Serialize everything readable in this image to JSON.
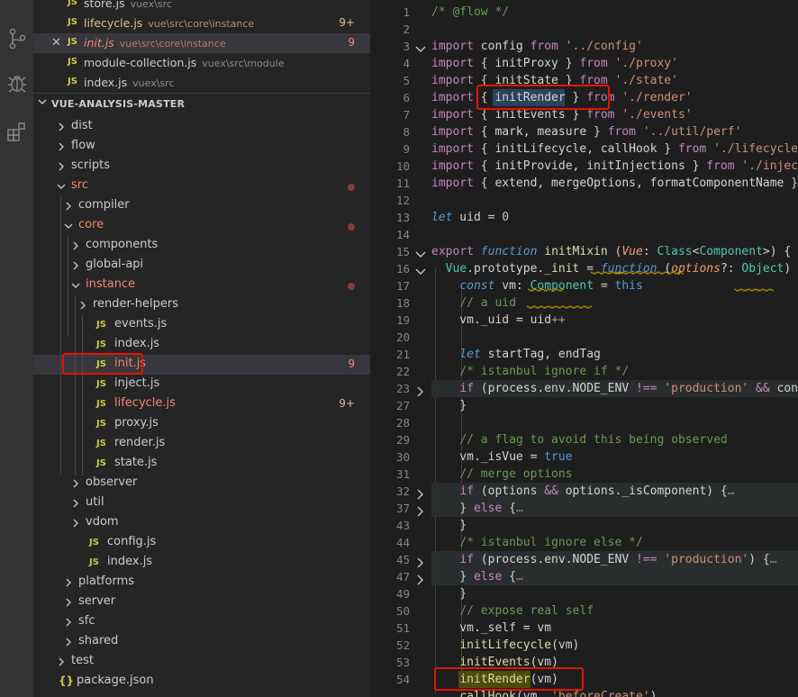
{
  "activity": [
    {
      "name": "source-control-icon"
    },
    {
      "name": "debug-icon"
    },
    {
      "name": "extensions-icon"
    }
  ],
  "open_editors": [
    {
      "name": "store.js",
      "path": "vuex\\src",
      "status": "normal",
      "badge": ""
    },
    {
      "name": "lifecycle.js",
      "path": "vue\\src\\core\\instance",
      "status": "modified",
      "badge": "9+"
    },
    {
      "name": "init.js",
      "path": "vue\\src\\core\\instance",
      "status": "error",
      "badge": "9"
    },
    {
      "name": "module-collection.js",
      "path": "vuex\\src\\module",
      "status": "normal",
      "badge": ""
    },
    {
      "name": "index.js",
      "path": "vuex\\src",
      "status": "normal",
      "badge": ""
    }
  ],
  "explorer": {
    "section_title": "VUE-ANALYSIS-MASTER",
    "tree": [
      {
        "label": "dist",
        "kind": "folder",
        "depth": 0,
        "expanded": false
      },
      {
        "label": "flow",
        "kind": "folder",
        "depth": 0,
        "expanded": false
      },
      {
        "label": "scripts",
        "kind": "folder",
        "depth": 0,
        "expanded": false
      },
      {
        "label": "src",
        "kind": "folder",
        "depth": 0,
        "expanded": true,
        "status": "err-dot"
      },
      {
        "label": "compiler",
        "kind": "folder",
        "depth": 1,
        "expanded": false
      },
      {
        "label": "core",
        "kind": "folder",
        "depth": 1,
        "expanded": true,
        "status": "err-dot"
      },
      {
        "label": "components",
        "kind": "folder",
        "depth": 2,
        "expanded": false
      },
      {
        "label": "global-api",
        "kind": "folder",
        "depth": 2,
        "expanded": false
      },
      {
        "label": "instance",
        "kind": "folder",
        "depth": 2,
        "expanded": true,
        "status": "err-dot"
      },
      {
        "label": "render-helpers",
        "kind": "folder",
        "depth": 3,
        "expanded": false
      },
      {
        "label": "events.js",
        "kind": "js",
        "depth": 3
      },
      {
        "label": "index.js",
        "kind": "js",
        "depth": 3
      },
      {
        "label": "init.js",
        "kind": "js",
        "depth": 3,
        "status": "err",
        "badge": "9",
        "selected": true
      },
      {
        "label": "inject.js",
        "kind": "js",
        "depth": 3
      },
      {
        "label": "lifecycle.js",
        "kind": "js",
        "depth": 3,
        "status": "mod",
        "badge": "9+"
      },
      {
        "label": "proxy.js",
        "kind": "js",
        "depth": 3
      },
      {
        "label": "render.js",
        "kind": "js",
        "depth": 3
      },
      {
        "label": "state.js",
        "kind": "js",
        "depth": 3
      },
      {
        "label": "observer",
        "kind": "folder",
        "depth": 2,
        "expanded": false
      },
      {
        "label": "util",
        "kind": "folder",
        "depth": 2,
        "expanded": false
      },
      {
        "label": "vdom",
        "kind": "folder",
        "depth": 2,
        "expanded": false
      },
      {
        "label": "config.js",
        "kind": "js",
        "depth": 2
      },
      {
        "label": "index.js",
        "kind": "js",
        "depth": 2
      },
      {
        "label": "platforms",
        "kind": "folder",
        "depth": 1,
        "expanded": false
      },
      {
        "label": "server",
        "kind": "folder",
        "depth": 1,
        "expanded": false
      },
      {
        "label": "sfc",
        "kind": "folder",
        "depth": 1,
        "expanded": false
      },
      {
        "label": "shared",
        "kind": "folder",
        "depth": 1,
        "expanded": false
      },
      {
        "label": "test",
        "kind": "folder",
        "depth": 0,
        "expanded": false
      },
      {
        "label": "package.json",
        "kind": "json",
        "depth": 0
      }
    ]
  },
  "editor": {
    "lines": [
      {
        "n": "1",
        "fold": "",
        "bg": false,
        "t": [
          [
            "/* @flow */",
            "cm"
          ]
        ]
      },
      {
        "n": "2",
        "fold": "",
        "bg": false,
        "t": []
      },
      {
        "n": "3",
        "fold": "open",
        "bg": false,
        "t": [
          [
            "import",
            "kw"
          ],
          [
            " config ",
            ""
          ],
          [
            "from",
            "kw"
          ],
          [
            " ",
            ""
          ],
          [
            "'../config'",
            "st"
          ]
        ]
      },
      {
        "n": "4",
        "fold": "",
        "bg": false,
        "t": [
          [
            "import",
            "kw"
          ],
          [
            " { initProxy } ",
            ""
          ],
          [
            "from",
            "kw"
          ],
          [
            " ",
            ""
          ],
          [
            "'./proxy'",
            "st"
          ]
        ]
      },
      {
        "n": "5",
        "fold": "",
        "bg": false,
        "t": [
          [
            "import",
            "kw"
          ],
          [
            " { initState } ",
            ""
          ],
          [
            "from",
            "kw"
          ],
          [
            " ",
            ""
          ],
          [
            "'./state'",
            "st"
          ]
        ]
      },
      {
        "n": "6",
        "fold": "",
        "bg": false,
        "t": [
          [
            "import",
            "kw"
          ],
          [
            " { initRender } ",
            ""
          ],
          [
            "from",
            "kw"
          ],
          [
            " ",
            ""
          ],
          [
            "'./render'",
            "st"
          ]
        ]
      },
      {
        "n": "7",
        "fold": "",
        "bg": false,
        "t": [
          [
            "import",
            "kw"
          ],
          [
            " { initEvents } ",
            ""
          ],
          [
            "from",
            "kw"
          ],
          [
            " ",
            ""
          ],
          [
            "'./events'",
            "st"
          ]
        ]
      },
      {
        "n": "8",
        "fold": "",
        "bg": false,
        "t": [
          [
            "import",
            "kw"
          ],
          [
            " { mark, measure } ",
            ""
          ],
          [
            "from",
            "kw"
          ],
          [
            " ",
            ""
          ],
          [
            "'../util/perf'",
            "st"
          ]
        ]
      },
      {
        "n": "9",
        "fold": "",
        "bg": false,
        "t": [
          [
            "import",
            "kw"
          ],
          [
            " { initLifecycle, callHook } ",
            ""
          ],
          [
            "from",
            "kw"
          ],
          [
            " ",
            ""
          ],
          [
            "'./lifecycle'",
            "st"
          ]
        ]
      },
      {
        "n": "10",
        "fold": "",
        "bg": false,
        "t": [
          [
            "import",
            "kw"
          ],
          [
            " { initProvide, initInjections } ",
            ""
          ],
          [
            "from",
            "kw"
          ],
          [
            " ",
            ""
          ],
          [
            "'./inject",
            "st"
          ]
        ]
      },
      {
        "n": "11",
        "fold": "",
        "bg": false,
        "t": [
          [
            "import",
            "kw"
          ],
          [
            " { extend, mergeOptions, formatComponentName }",
            ""
          ]
        ]
      },
      {
        "n": "12",
        "fold": "",
        "bg": false,
        "t": []
      },
      {
        "n": "13",
        "fold": "",
        "bg": false,
        "t": [
          [
            "let",
            "sk"
          ],
          [
            " uid = ",
            ""
          ],
          [
            "0",
            "nm"
          ]
        ]
      },
      {
        "n": "14",
        "fold": "",
        "bg": false,
        "t": []
      },
      {
        "n": "15",
        "fold": "open",
        "bg": false,
        "t": [
          [
            "export",
            "kw"
          ],
          [
            " ",
            ""
          ],
          [
            "function",
            "sk"
          ],
          [
            " ",
            ""
          ],
          [
            "initMixin",
            "fn"
          ],
          [
            " (",
            ""
          ],
          [
            "Vue",
            "pa"
          ],
          [
            ": ",
            ""
          ],
          [
            "Class",
            "ty"
          ],
          [
            "<",
            ""
          ],
          [
            "Component",
            "ty"
          ],
          [
            ">) {",
            ""
          ]
        ]
      },
      {
        "n": "16",
        "fold": "open",
        "bg": false,
        "t": [
          [
            "  Vue",
            "ty"
          ],
          [
            ".prototype.",
            ""
          ],
          [
            "_init",
            "fn"
          ],
          [
            " = ",
            ""
          ],
          [
            "function",
            "sk"
          ],
          [
            " (",
            ""
          ],
          [
            "options",
            "pa"
          ],
          [
            "?: ",
            ""
          ],
          [
            "Object",
            "ty"
          ],
          [
            ") {",
            ""
          ]
        ]
      },
      {
        "n": "17",
        "fold": "",
        "bg": false,
        "t": [
          [
            "    ",
            ""
          ],
          [
            "const",
            "sk"
          ],
          [
            " vm: ",
            ""
          ],
          [
            "Component",
            "ty"
          ],
          [
            " = ",
            ""
          ],
          [
            "this",
            "bl"
          ]
        ]
      },
      {
        "n": "18",
        "fold": "",
        "bg": false,
        "t": [
          [
            "    ",
            ""
          ],
          [
            "// a uid",
            "cm"
          ]
        ]
      },
      {
        "n": "19",
        "fold": "",
        "bg": false,
        "t": [
          [
            "    vm._uid = uid",
            ""
          ],
          [
            "++",
            "kw"
          ]
        ]
      },
      {
        "n": "20",
        "fold": "",
        "bg": false,
        "t": []
      },
      {
        "n": "21",
        "fold": "",
        "bg": false,
        "t": [
          [
            "    ",
            ""
          ],
          [
            "let",
            "sk"
          ],
          [
            " startTag, endTag",
            ""
          ]
        ]
      },
      {
        "n": "22",
        "fold": "",
        "bg": false,
        "t": [
          [
            "    ",
            ""
          ],
          [
            "/* istanbul ignore if */",
            "cm"
          ]
        ]
      },
      {
        "n": "23",
        "fold": "closed",
        "bg": true,
        "t": [
          [
            "    ",
            ""
          ],
          [
            "if",
            "kw"
          ],
          [
            " (process.env.NODE_ENV ",
            ""
          ],
          [
            "!==",
            "kw"
          ],
          [
            " ",
            ""
          ],
          [
            "'production'",
            "st"
          ],
          [
            " ",
            ""
          ],
          [
            "&&",
            "kw"
          ],
          [
            " conf",
            ""
          ]
        ]
      },
      {
        "n": "27",
        "fold": "",
        "bg": false,
        "t": [
          [
            "    }",
            ""
          ]
        ]
      },
      {
        "n": "28",
        "fold": "",
        "bg": false,
        "t": []
      },
      {
        "n": "29",
        "fold": "",
        "bg": false,
        "t": [
          [
            "    ",
            ""
          ],
          [
            "// a flag to avoid this being observed",
            "cm"
          ]
        ]
      },
      {
        "n": "30",
        "fold": "",
        "bg": false,
        "t": [
          [
            "    vm._isVue = ",
            ""
          ],
          [
            "true",
            "bl"
          ]
        ]
      },
      {
        "n": "31",
        "fold": "",
        "bg": false,
        "t": [
          [
            "    ",
            ""
          ],
          [
            "// merge options",
            "cm"
          ]
        ]
      },
      {
        "n": "32",
        "fold": "closed",
        "bg": true,
        "t": [
          [
            "    ",
            ""
          ],
          [
            "if",
            "kw"
          ],
          [
            " (options ",
            ""
          ],
          [
            "&&",
            "kw"
          ],
          [
            " options._isComponent) {",
            ""
          ],
          [
            "…",
            "ellip"
          ]
        ]
      },
      {
        "n": "37",
        "fold": "closed",
        "bg": true,
        "t": [
          [
            "    } ",
            ""
          ],
          [
            "else",
            "kw"
          ],
          [
            " {",
            ""
          ],
          [
            "…",
            "ellip"
          ]
        ]
      },
      {
        "n": "43",
        "fold": "",
        "bg": false,
        "t": [
          [
            "    }",
            ""
          ]
        ]
      },
      {
        "n": "44",
        "fold": "",
        "bg": false,
        "t": [
          [
            "    ",
            ""
          ],
          [
            "/* istanbul ignore else */",
            "cm"
          ]
        ]
      },
      {
        "n": "45",
        "fold": "closed",
        "bg": true,
        "t": [
          [
            "    ",
            ""
          ],
          [
            "if",
            "kw"
          ],
          [
            " (process.env.NODE_ENV ",
            ""
          ],
          [
            "!==",
            "kw"
          ],
          [
            " ",
            ""
          ],
          [
            "'production'",
            "st"
          ],
          [
            ") {",
            ""
          ],
          [
            "…",
            "ellip"
          ]
        ]
      },
      {
        "n": "47",
        "fold": "closed",
        "bg": true,
        "t": [
          [
            "    } ",
            ""
          ],
          [
            "else",
            "kw"
          ],
          [
            " {",
            ""
          ],
          [
            "…",
            "ellip"
          ]
        ]
      },
      {
        "n": "49",
        "fold": "",
        "bg": false,
        "t": [
          [
            "    }",
            ""
          ]
        ]
      },
      {
        "n": "50",
        "fold": "",
        "bg": false,
        "t": [
          [
            "    ",
            ""
          ],
          [
            "// expose real self",
            "cm"
          ]
        ]
      },
      {
        "n": "51",
        "fold": "",
        "bg": false,
        "t": [
          [
            "    vm._self = vm",
            ""
          ]
        ]
      },
      {
        "n": "52",
        "fold": "",
        "bg": false,
        "t": [
          [
            "    ",
            ""
          ],
          [
            "initLifecycle",
            "fn"
          ],
          [
            "(vm)",
            ""
          ]
        ]
      },
      {
        "n": "53",
        "fold": "",
        "bg": false,
        "t": [
          [
            "    ",
            ""
          ],
          [
            "initEvents",
            "fn"
          ],
          [
            "(vm)",
            ""
          ]
        ]
      },
      {
        "n": "54",
        "fold": "",
        "bg": false,
        "t": [
          [
            "    ",
            ""
          ],
          [
            "initRender",
            "fn"
          ],
          [
            "(vm)",
            ""
          ]
        ]
      },
      {
        "n": "",
        "fold": "",
        "bg": false,
        "t": [
          [
            "    ",
            ""
          ],
          [
            "callHook",
            "fn"
          ],
          [
            "(vm, ",
            ""
          ],
          [
            "'beforeCreate'",
            "st"
          ],
          [
            ")",
            ""
          ]
        ]
      }
    ]
  }
}
